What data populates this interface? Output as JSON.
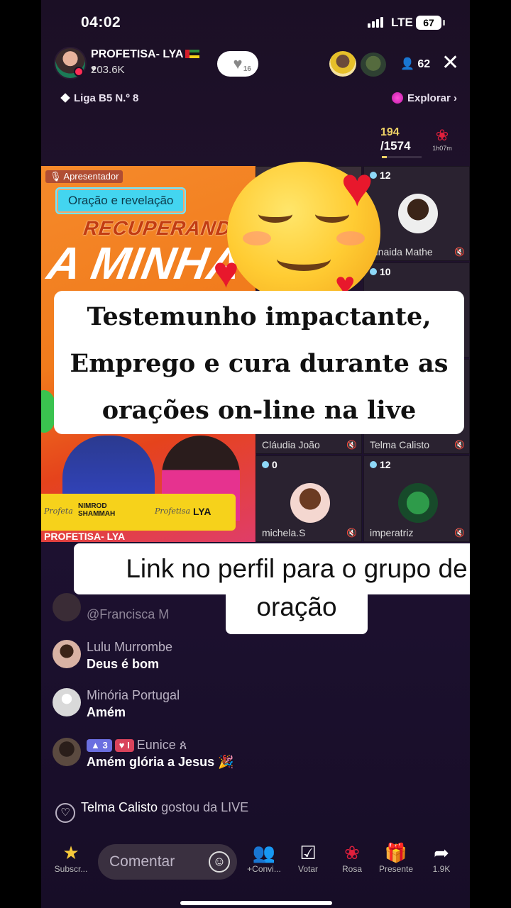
{
  "status_bar": {
    "time": "04:02",
    "network": "LTE",
    "battery": "67"
  },
  "host": {
    "name": "PROFETISA- LYA",
    "likes": "203.6K",
    "follow_count": "16"
  },
  "viewer_count": "62",
  "league": "Liga B5 N.º 8",
  "explore_label": "Explorar",
  "goal": {
    "current": "194",
    "total": "/1574",
    "timer": "1h07m"
  },
  "stage": {
    "presenter_label": "Apresentador",
    "topic_tag": "Oração e revelação",
    "banner_line1": "RECUPERANDO",
    "banner_line2": "A MINHA",
    "namebar_left": "NIMROD SHAMMAH",
    "namebar_right": "LYA",
    "host_footer": "PROFETISA- LYA",
    "guests": [
      {
        "count": "12",
        "name": "Zinaida Mathe"
      },
      {
        "count": "10",
        "name": ""
      },
      {
        "count": "",
        "name": "Cláudia João"
      },
      {
        "count": "",
        "name": "Telma Calisto"
      },
      {
        "count": "0",
        "name": "michela.S"
      },
      {
        "count": "12",
        "name": "imperatriz"
      }
    ]
  },
  "overlay": {
    "card_lines": [
      "Testemunho impactante,",
      "Emprego e cura durante as",
      "orações on-line na live"
    ],
    "caption_line1": "Link no perfil para o grupo de",
    "caption_line2": "oração"
  },
  "chat": [
    {
      "user": "@Francisca M",
      "text": ""
    },
    {
      "user": "Lulu Murrombe",
      "text": "Deus é bom"
    },
    {
      "user": "Minória Portugal",
      "text": "Amém"
    },
    {
      "user": "Eunice",
      "level": "3",
      "badge": "I",
      "text": "Amém glória a Jesus 🎉"
    }
  ],
  "like_event": {
    "user": "Telma Calisto",
    "text": "gostou da LIVE"
  },
  "bottom_bar": {
    "subscribe": "Subscr...",
    "comment_placeholder": "Comentar",
    "invite": "+Convi...",
    "vote": "Votar",
    "rose": "Rosa",
    "gift": "Presente",
    "share": "1.9K"
  },
  "colors": {
    "accent_orange": "#f17b1c",
    "tag_cyan": "#43d5f0",
    "namebar_yellow": "#f6d21b",
    "heart_red": "#e8182c"
  },
  "icons": [
    "signal-icon",
    "battery-icon",
    "heart-icon",
    "close-icon",
    "person-icon",
    "diamond-icon",
    "rose-icon",
    "star-icon",
    "smiley-icon",
    "people-icon",
    "vote-icon",
    "gift-icon",
    "share-icon",
    "mic-off-icon"
  ]
}
